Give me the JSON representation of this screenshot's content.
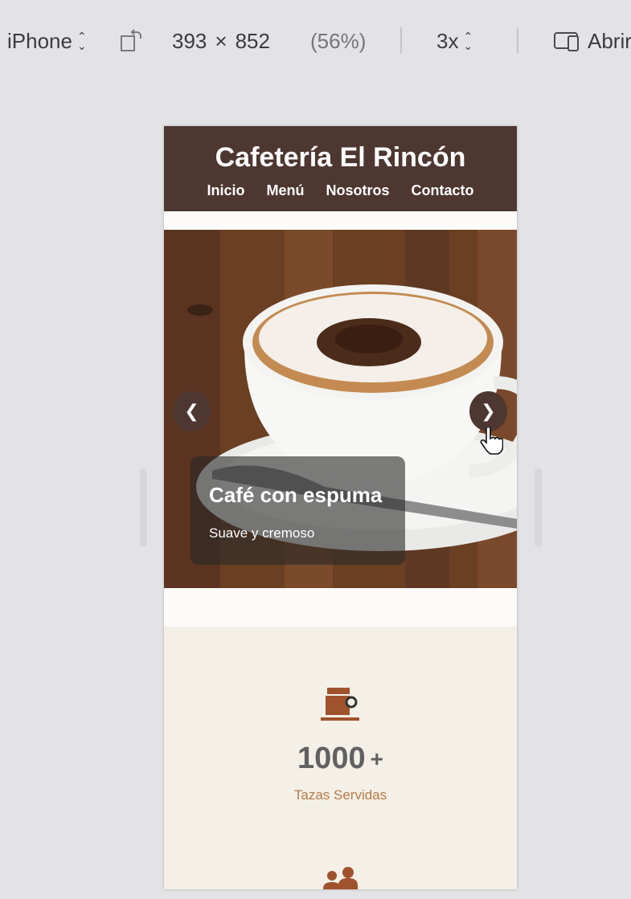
{
  "devtools": {
    "device": "iPhone",
    "width": "393",
    "times": "×",
    "height": "852",
    "zoom": "(56%)",
    "dpr": "3x",
    "open_label": "Abrir"
  },
  "site": {
    "title": "Cafetería El Rincón",
    "nav": [
      "Inicio",
      "Menú",
      "Nosotros",
      "Contacto"
    ]
  },
  "carousel": {
    "prev_label": "❮",
    "next_label": "❯",
    "caption_title": "Café con espuma",
    "caption_text": "Suave y cremoso"
  },
  "stats": {
    "number": "1000",
    "plus": "+",
    "label": "Tazas Servidas",
    "icons": [
      "coffee-machine-icon",
      "people-icon"
    ]
  },
  "colors": {
    "header_bg": "#4d3730",
    "stats_bg": "#f4f0e8",
    "accent": "#a0522d",
    "label": "#b57a45"
  }
}
